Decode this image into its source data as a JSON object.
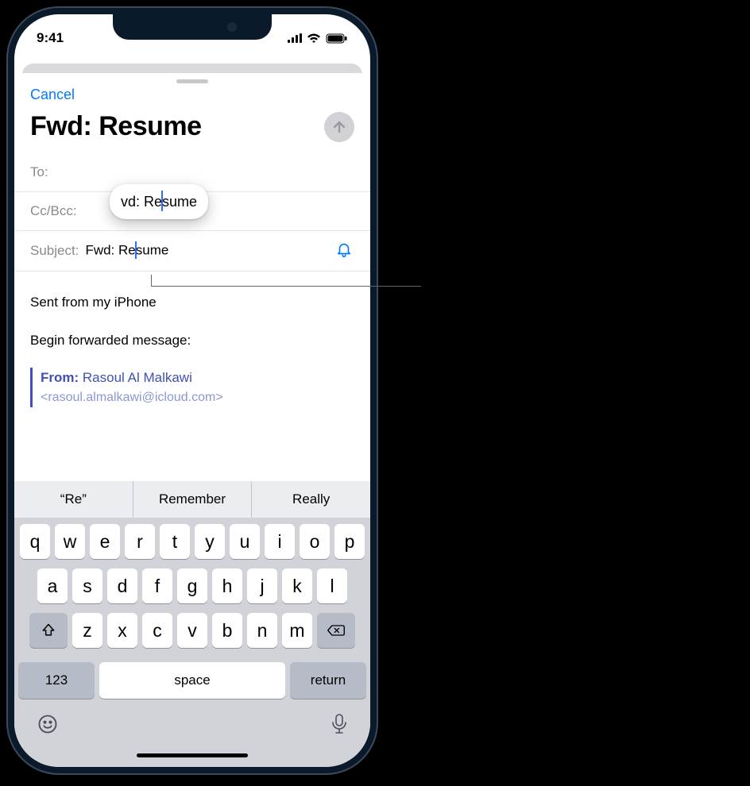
{
  "status": {
    "time": "9:41"
  },
  "nav": {
    "cancel": "Cancel"
  },
  "header": {
    "title": "Fwd: Resume"
  },
  "fields": {
    "to_label": "To:",
    "ccbcc_label": "Cc/Bcc:",
    "subject_label": "Subject:",
    "subject_value_pre": "Fwd: Re",
    "subject_value_post": "sume"
  },
  "magnifier": {
    "pre": "vd: Re",
    "post": "sume"
  },
  "body": {
    "signature": "Sent from my iPhone",
    "begin_fwd": "Begin forwarded message:",
    "from_label": "From:",
    "from_name": "Rasoul Al Malkawi",
    "from_email": "<rasoul.almalkawi@icloud.com>"
  },
  "keyboard": {
    "suggestions": [
      "“Re”",
      "Remember",
      "Really"
    ],
    "row1": [
      "q",
      "w",
      "e",
      "r",
      "t",
      "y",
      "u",
      "i",
      "o",
      "p"
    ],
    "row2": [
      "a",
      "s",
      "d",
      "f",
      "g",
      "h",
      "j",
      "k",
      "l"
    ],
    "row3": [
      "z",
      "x",
      "c",
      "v",
      "b",
      "n",
      "m"
    ],
    "k123": "123",
    "space": "space",
    "return": "return"
  }
}
